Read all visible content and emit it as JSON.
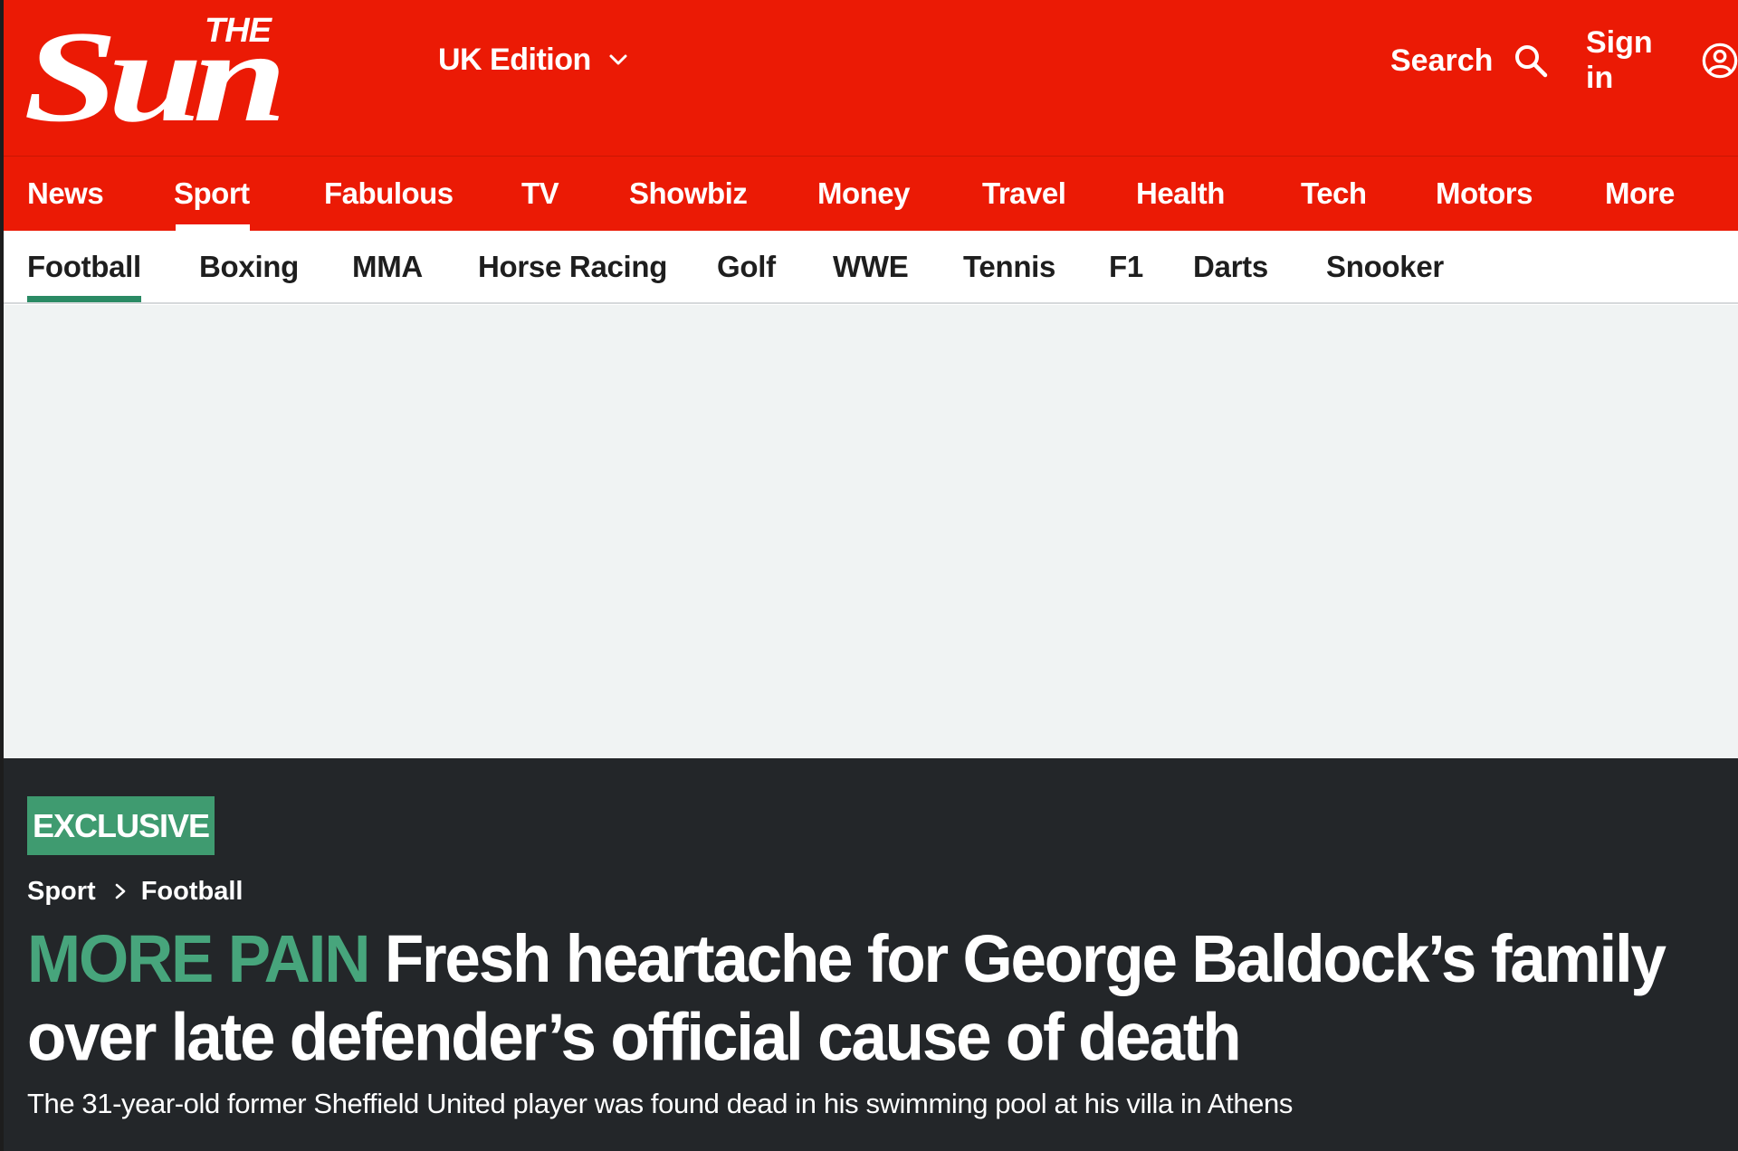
{
  "masthead": {
    "logo_alt": "The Sun",
    "logo_the": "THE",
    "logo_sun": "Sun",
    "edition_label": "UK Edition",
    "search_label": "Search",
    "signin_label": "Sign in",
    "colors": {
      "brand_red": "#eb1a05",
      "white": "#ffffff"
    }
  },
  "primary_nav": {
    "items": [
      {
        "label": "News"
      },
      {
        "label": "Sport",
        "active": true
      },
      {
        "label": "Fabulous"
      },
      {
        "label": "TV"
      },
      {
        "label": "Showbiz"
      },
      {
        "label": "Money"
      },
      {
        "label": "Travel"
      },
      {
        "label": "Health"
      },
      {
        "label": "Tech"
      },
      {
        "label": "Motors"
      },
      {
        "label": "More"
      }
    ]
  },
  "secondary_nav": {
    "items": [
      {
        "label": "Football",
        "active": true
      },
      {
        "label": "Boxing"
      },
      {
        "label": "MMA"
      },
      {
        "label": "Horse Racing"
      },
      {
        "label": "Golf"
      },
      {
        "label": "WWE"
      },
      {
        "label": "Tennis"
      },
      {
        "label": "F1"
      },
      {
        "label": "Darts"
      },
      {
        "label": "Snooker"
      }
    ],
    "accent_color": "#2a8a64"
  },
  "article": {
    "badge": "EXCLUSIVE",
    "breadcrumb": [
      "Sport",
      "Football"
    ],
    "kicker": "MORE PAIN",
    "headline": "Fresh heartache for George Baldock’s family over late defender’s official cause of death",
    "standfirst": "The 31-year-old former Sheffield United player was found dead in his swimming pool at his villa in Athens",
    "colors": {
      "background": "#232629",
      "kicker": "#47a57c",
      "badge": "#3f9b70"
    }
  }
}
